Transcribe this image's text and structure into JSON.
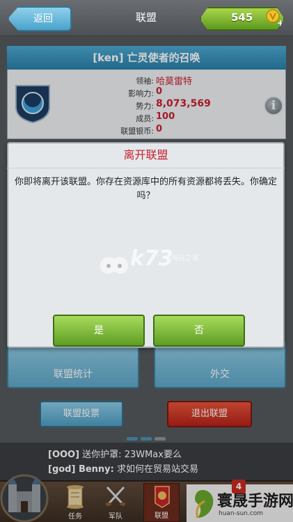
{
  "topbar": {
    "back_label": "返回",
    "title": "联盟",
    "gold_amount": "545",
    "plus_glyph": "+"
  },
  "alliance": {
    "header": "[ken] 亡灵使者的召唤",
    "info": [
      {
        "label": "领袖:",
        "value": "哈莫雷特"
      },
      {
        "label": "影响力:",
        "value": "0"
      },
      {
        "label": "势力:",
        "value": "8,073,569"
      },
      {
        "label": "成员:",
        "value": "100"
      },
      {
        "label": "联盟银币:",
        "value": "0"
      }
    ],
    "info_glyph": "i"
  },
  "modal": {
    "title": "离开联盟",
    "message": "你即将离开该联盟。你存在资源库中的所有资源都将丢失。你确定吗？",
    "yes_label": "是",
    "no_label": "否"
  },
  "tiles": {
    "stats_label": "联盟统计",
    "diplomacy_label": "外交"
  },
  "actions": {
    "vote_label": "联盟投票",
    "leave_label": "退出联盟"
  },
  "chat": [
    {
      "user": "[OOO]",
      "text": " 送你护罩: 23WMax要么"
    },
    {
      "user": "[god] Benny:",
      "text": " 求如何在贸易站交易"
    }
  ],
  "nav": [
    {
      "label": "任务",
      "icon": "scroll-icon"
    },
    {
      "label": "军队",
      "icon": "crossed-swords-icon"
    },
    {
      "label": "联盟",
      "icon": "banner-icon"
    }
  ],
  "nav_badge": "4",
  "watermarks": {
    "k73": "k73",
    "k73_sub": "电玩之家",
    "site_title": "寰晟手游网",
    "site_url": "huan-sun.com"
  },
  "colors": {
    "accent_blue": "#3b93c0",
    "danger_red": "#c8202e",
    "confirm_green": "#6aa82c"
  }
}
